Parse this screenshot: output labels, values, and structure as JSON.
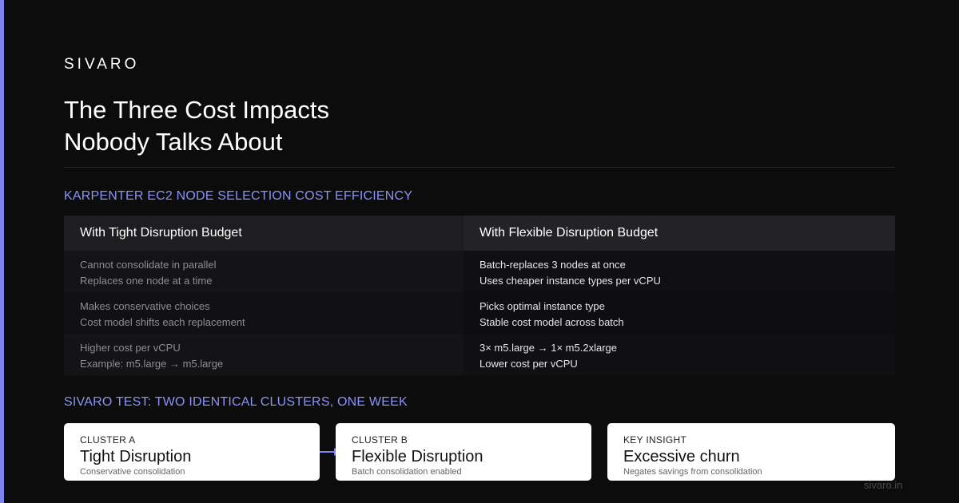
{
  "brand": "SIVARO",
  "title_line1": "The Three Cost Impacts",
  "title_line2": "Nobody Talks About",
  "section1_label": "KARPENTER EC2 NODE SELECTION COST EFFICIENCY",
  "comparison": {
    "left_header": "With Tight Disruption Budget",
    "right_header": "With Flexible Disruption Budget",
    "rows": [
      {
        "left": [
          "Cannot consolidate in parallel",
          "Replaces one node at a time"
        ],
        "right": [
          "Batch-replaces 3 nodes at once",
          "Uses cheaper instance types per vCPU"
        ]
      },
      {
        "left": [
          "Makes conservative choices",
          "Cost model shifts each replacement"
        ],
        "right": [
          "Picks optimal instance type",
          "Stable cost model across batch"
        ]
      },
      {
        "left": [
          "Higher cost per vCPU",
          "Example: m5.large → m5.large"
        ],
        "right": [
          "3× m5.large → 1× m5.2xlarge",
          "Lower cost per vCPU"
        ]
      }
    ]
  },
  "section2_label": "SIVARO TEST: TWO IDENTICAL CLUSTERS, ONE WEEK",
  "cards": [
    {
      "label": "CLUSTER A",
      "title": "Tight Disruption",
      "subtitle": "Conservative consolidation"
    },
    {
      "label": "CLUSTER B",
      "title": "Flexible Disruption",
      "subtitle": "Batch consolidation enabled"
    },
    {
      "label": "KEY INSIGHT",
      "title": "Excessive churn",
      "subtitle": "Negates savings from consolidation"
    }
  ],
  "footer_url": "sivaro.in",
  "colors": {
    "accent": "#7b84f0",
    "section_label": "#8b93f5",
    "background": "#0c0c0d"
  }
}
